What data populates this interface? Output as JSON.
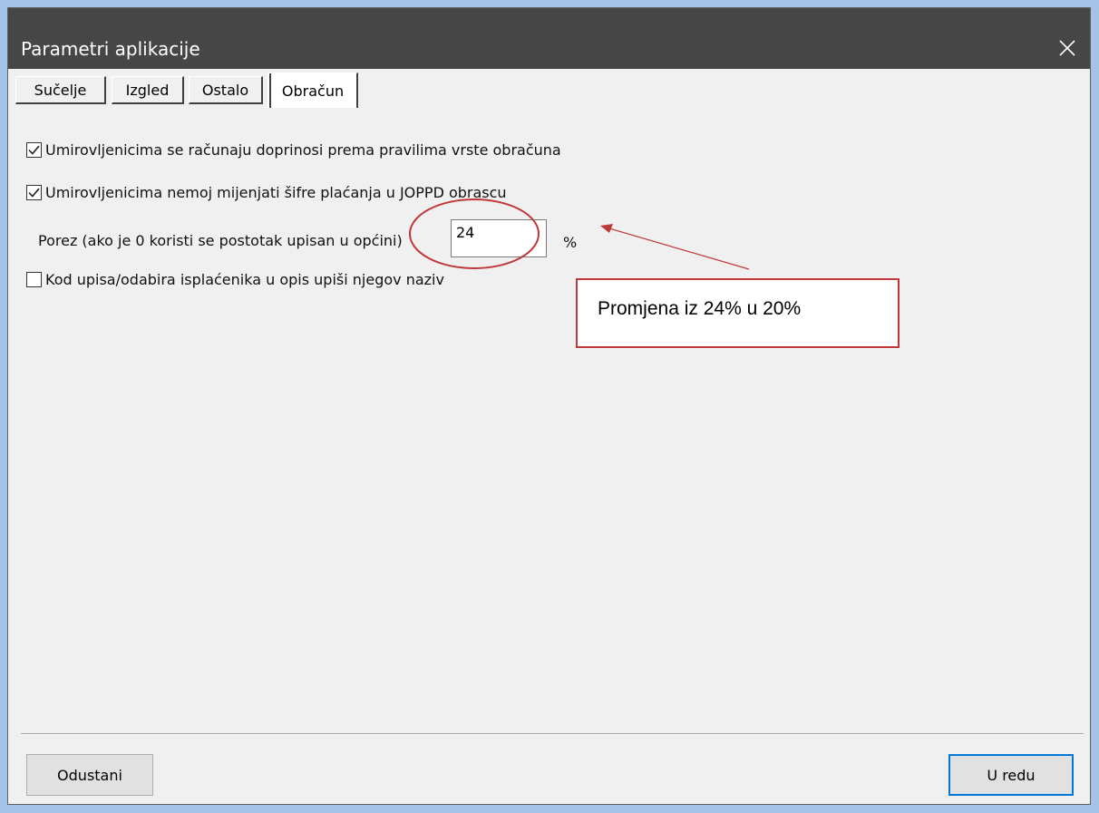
{
  "window": {
    "title": "Parametri aplikacije"
  },
  "tabs": [
    {
      "label": "Sučelje"
    },
    {
      "label": "Izgled"
    },
    {
      "label": "Ostalo"
    },
    {
      "label": "Obračun"
    }
  ],
  "active_tab": "Obračun",
  "options": [
    {
      "label": "Umirovljenicima se računaju doprinosi prema pravilima vrste obračuna",
      "checked": true
    },
    {
      "label": "Umirovljenicima nemoj mijenjati šifre plaćanja u JOPPD obrascu",
      "checked": true
    },
    {
      "label": "Kod upisa/odabira isplaćenika u opis upiši njegov naziv",
      "checked": false
    }
  ],
  "tax_field": {
    "label": "Porez (ako je 0 koristi se postotak upisan u općini)",
    "value": "24",
    "unit": "%"
  },
  "annotation": {
    "text": "Promjena iz 24% u 20%",
    "color": "#c0373a"
  },
  "buttons": {
    "cancel": "Odustani",
    "ok": "U redu"
  },
  "colors": {
    "titlebar": "#464646",
    "accent": "#0078d7",
    "annotation": "#c0373a"
  }
}
